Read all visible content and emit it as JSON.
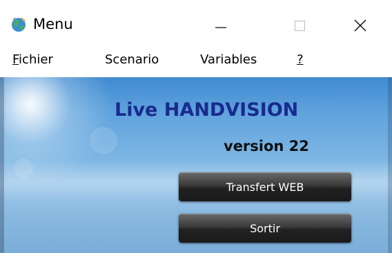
{
  "window": {
    "title": "Menu",
    "controls": {
      "minimize_icon": "minimize-icon",
      "maximize_icon": "maximize-icon",
      "close_icon": "close-icon"
    }
  },
  "menubar": {
    "items": [
      {
        "label": "Fichier"
      },
      {
        "label": "Scenario"
      },
      {
        "label": "Variables"
      },
      {
        "label": "?"
      }
    ]
  },
  "main": {
    "title": "Live HANDVISION",
    "version": "version 22",
    "buttons": {
      "transfert_label": "Transfert WEB",
      "sortir_label": "Sortir"
    }
  },
  "colors": {
    "title_text": "#1a2a8e",
    "button_bg": "#2a2a2a",
    "background_top": "#3f8ad0",
    "background_bottom": "#7aaed8"
  }
}
